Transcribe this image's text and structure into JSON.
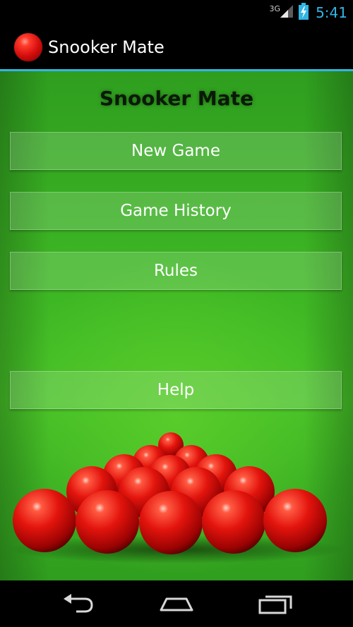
{
  "status_bar": {
    "network_type": "3G",
    "clock": "5:41",
    "signal_icon": "signal-icon",
    "battery_icon": "battery-charging-icon",
    "clock_color": "#33b5e5"
  },
  "action_bar": {
    "app_icon": "red-snooker-ball-icon",
    "title": "Snooker Mate",
    "accent_color": "#33b5e5"
  },
  "main": {
    "heading": "Snooker Mate",
    "buttons": {
      "new_game": "New Game",
      "game_history": "Game History",
      "rules": "Rules",
      "help": "Help"
    },
    "background_image": "red-balls-triangle-on-green-felt"
  },
  "nav_bar": {
    "back_icon": "back-icon",
    "home_icon": "home-icon",
    "recents_icon": "recent-apps-icon"
  }
}
